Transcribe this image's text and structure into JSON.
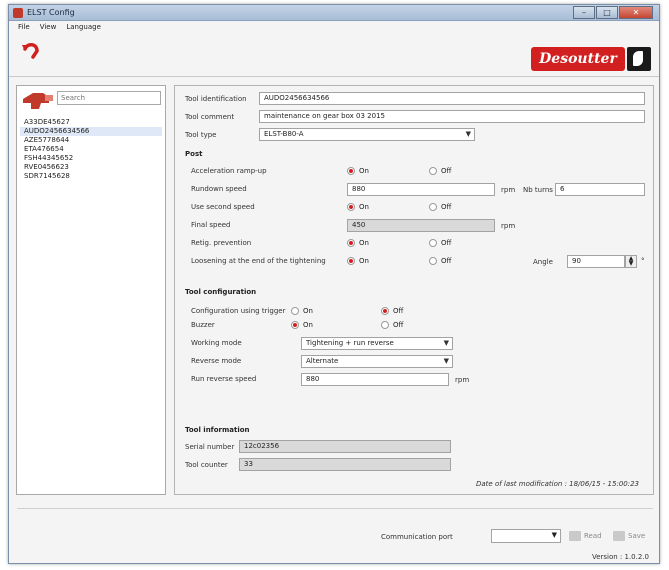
{
  "window": {
    "title": "ELST Config"
  },
  "menu": [
    "File",
    "View",
    "Language"
  ],
  "brand": {
    "name": "Desoutter"
  },
  "search": {
    "placeholder": "Search"
  },
  "tools": [
    "A33DE45627",
    "AUDO2456634566",
    "AZE5778644",
    "ETA476654",
    "FSH44345652",
    "RVE0456623",
    "SDR7145628"
  ],
  "selected_tool_index": 1,
  "identification": {
    "tool_identification_label": "Tool identification",
    "tool_identification_value": "AUDO2456634566",
    "tool_comment_label": "Tool comment",
    "tool_comment_value": "maintenance on gear box 03 2015",
    "tool_type_label": "Tool type",
    "tool_type_value": "ELST-B80-A"
  },
  "post": {
    "title": "Post",
    "acceleration_label": "Acceleration ramp-up",
    "rundown_speed_label": "Rundown speed",
    "rundown_speed_value": "880",
    "rpm": "rpm",
    "nb_turns_label": "Nb turns",
    "nb_turns_value": "6",
    "second_speed_label": "Use second speed",
    "final_speed_label": "Final speed",
    "final_speed_value": "450",
    "retightening_label": "Retig. prevention",
    "loosening_label": "Loosening at the end of the tightening",
    "angle_label": "Angle",
    "angle_value": "90",
    "angle_unit": "°",
    "on": "On",
    "off": "Off"
  },
  "tool_config": {
    "title": "Tool configuration",
    "config_trigger_label": "Configuration using trigger",
    "buzzer_label": "Buzzer",
    "working_mode_label": "Working mode",
    "working_mode_value": "Tightening + run reverse",
    "reverse_mode_label": "Reverse mode",
    "reverse_mode_value": "Alternate",
    "run_reverse_speed_label": "Run reverse speed",
    "run_reverse_speed_value": "880",
    "rpm": "rpm",
    "on": "On",
    "off": "Off"
  },
  "tool_info": {
    "title": "Tool information",
    "serial_label": "Serial number",
    "serial_value": "12c02356",
    "counter_label": "Tool counter",
    "counter_value": "33"
  },
  "last_modification": "Date of last modification : 18/06/15 - 15:00:23",
  "footer": {
    "comm_port_label": "Communication port",
    "read_label": "Read",
    "save_label": "Save",
    "version": "Version : 1.0.2.0"
  }
}
